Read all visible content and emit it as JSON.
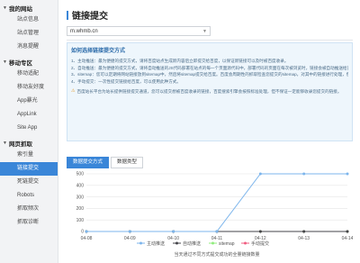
{
  "sidebar": {
    "sections": [
      {
        "label": "我的网站",
        "items": [
          {
            "label": "站点信息"
          },
          {
            "label": "站点管理"
          },
          {
            "label": "消息提醒"
          }
        ]
      },
      {
        "label": "移动专区",
        "items": [
          {
            "label": "移动适配"
          },
          {
            "label": "移动友好度"
          },
          {
            "label": "App暴光"
          },
          {
            "label": "AppLink"
          },
          {
            "label": "Site App"
          }
        ]
      },
      {
        "label": "网页抓取",
        "items": [
          {
            "label": "索引量"
          },
          {
            "label": "链接提交",
            "active": true
          },
          {
            "label": "死链提交"
          },
          {
            "label": "Robots"
          },
          {
            "label": "抓取频次"
          },
          {
            "label": "抓取诊断"
          }
        ]
      }
    ]
  },
  "main": {
    "title": "链接提交",
    "site": "m.whmb.cn",
    "info": {
      "heading": "如何选择链接提交方式",
      "lines": [
        "1、主动推送：最为便捷的提交方式，请将百度站点生成新内容后立即提交给百度，以保证新链接可以及时被百度收录。",
        "2、自动推送：最为便捷的提交方式，请将自动推送的JS代码部署在站点的每一个页面源代码中，部署代码的页面在每次被浏览时，链接会被自动推送给百度。可以与主动推送配合使用。",
        "3、sitemap：您可以定期将网站链接放到sitemap中，然后将sitemap提交给百度。百度会周期性的抓取检查您提交的sitemap，对其中的链接进行处理，但收录速度慢于主动推送。",
        "4、手动提交：一次性提交链接给百度，可以使用此种方式。"
      ],
      "notice": "百度站长平台为站长提供链接提交通道，您可以提交想被百度收录的链接，百度搜索引擎会按照标准处理，但不保证一定能够收录您提交的链接。"
    },
    "tabs": [
      {
        "label": "数据提交方式",
        "active": true
      },
      {
        "label": "数据类型",
        "active": false
      }
    ]
  },
  "chart_data": {
    "type": "line",
    "x": [
      "04-08",
      "04-09",
      "04-10",
      "04-11",
      "04-12",
      "04-13",
      "04-14"
    ],
    "ylim": [
      0,
      500
    ],
    "yticks": [
      0,
      100,
      200,
      300,
      400,
      500
    ],
    "grid": true,
    "legend_position": "bottom",
    "series": [
      {
        "name": "主动推送",
        "color": "#7cb5ec",
        "values": [
          0,
          0,
          0,
          0,
          500,
          500,
          500
        ]
      },
      {
        "name": "自动推送",
        "color": "#434348",
        "values": [
          0,
          0,
          0,
          0,
          0,
          0,
          0
        ]
      },
      {
        "name": "sitemap",
        "color": "#90ed7d",
        "values": [
          0,
          0,
          0,
          0,
          0,
          0,
          0
        ]
      },
      {
        "name": "手动提交",
        "color": "#f15c80",
        "values": [
          0,
          0,
          0,
          0,
          0,
          0,
          0
        ]
      }
    ],
    "caption": "当天通过不同方式提交成功的全量链接数量"
  }
}
